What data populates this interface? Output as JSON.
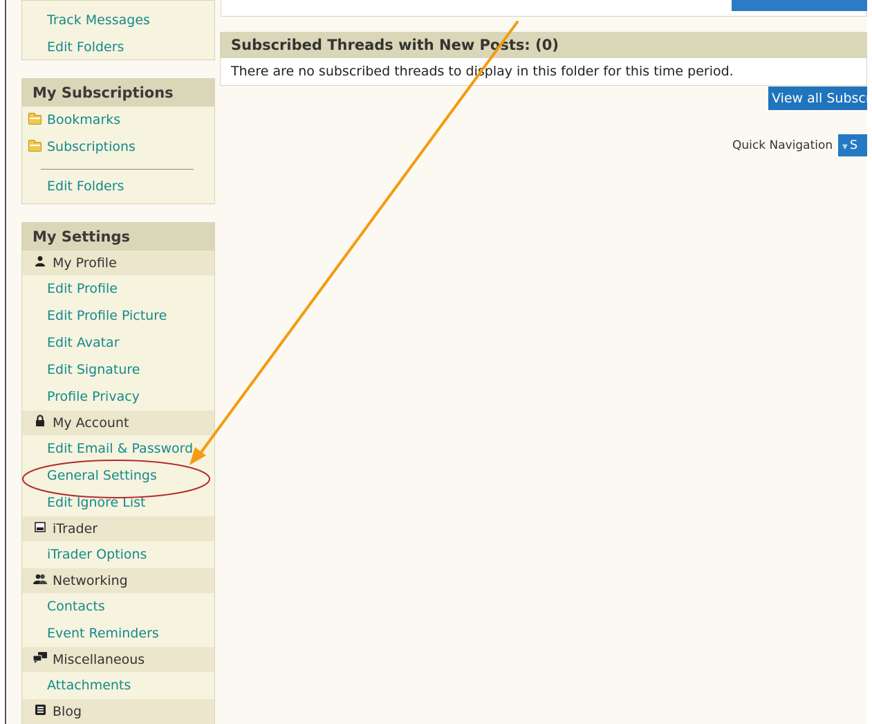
{
  "sidebar": {
    "top_block": {
      "items": [
        "Track Messages",
        "Edit Folders"
      ]
    },
    "subscriptions": {
      "title": "My Subscriptions",
      "folders": [
        "Bookmarks",
        "Subscriptions"
      ],
      "edit": "Edit Folders"
    },
    "settings": {
      "title": "My Settings",
      "profile": {
        "label": "My Profile",
        "icon": "user-icon",
        "items": [
          "Edit Profile",
          "Edit Profile Picture",
          "Edit Avatar",
          "Edit Signature",
          "Profile Privacy"
        ]
      },
      "account": {
        "label": "My Account",
        "icon": "lock-icon",
        "items": [
          "Edit Email & Password",
          "General Settings",
          "Edit Ignore List"
        ]
      },
      "itrader": {
        "label": "iTrader",
        "icon": "itrader-icon",
        "items": [
          "iTrader Options"
        ]
      },
      "networking": {
        "label": "Networking",
        "icon": "people-icon",
        "items": [
          "Contacts",
          "Event Reminders"
        ]
      },
      "misc": {
        "label": "Miscellaneous",
        "icon": "chat-icon",
        "items": [
          "Attachments"
        ]
      },
      "blog": {
        "label": "Blog",
        "icon": "blog-icon"
      }
    }
  },
  "main": {
    "section_title": "Subscribed Threads with New Posts: (0)",
    "empty_message": "There are no subscribed threads to display in this folder for this time period.",
    "view_all_button": "View all Subscr",
    "quick_nav_label": "Quick Navigation",
    "quick_nav_button": "S"
  },
  "annotation": {
    "arrow_color": "#f49b0f",
    "circle_color": "#b52a2a"
  },
  "colors": {
    "link": "#148a8a",
    "header_bg": "#dad6b8",
    "button_blue": "#1f74bd"
  }
}
